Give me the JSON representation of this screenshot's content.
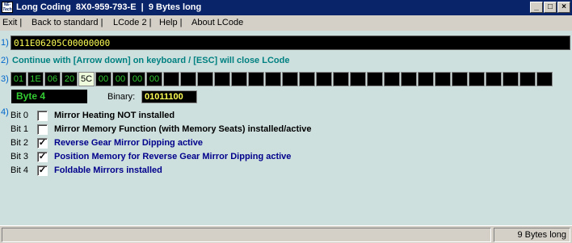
{
  "window": {
    "icon_text": "NE-Tech",
    "title": "Long Coding  8X0-959-793-E  |  9 Bytes long",
    "buttons": {
      "minimize": "_",
      "maximize": "□",
      "close": "×"
    }
  },
  "menu": [
    "Exit |",
    "Back to standard |",
    "LCode 2 |",
    "Help |",
    "About LCode"
  ],
  "step_numbers": [
    "1)",
    "2)",
    "3)",
    "4)"
  ],
  "coding_string": "011E06205C00000000",
  "hint": "Continue with [Arrow down] on keyboard / [ESC] will close LCode",
  "bytes": [
    "01",
    "1E",
    "06",
    "20",
    "5C",
    "00",
    "00",
    "00",
    "00",
    "",
    "",
    "",
    "",
    "",
    "",
    "",
    "",
    "",
    "",
    "",
    "",
    "",
    "",
    "",
    "",
    "",
    "",
    "",
    "",
    "",
    "",
    ""
  ],
  "selected_byte_index": 4,
  "byte_label": "Byte 4",
  "binary_label": "Binary:",
  "binary_value": "01011100",
  "bits": [
    {
      "name": "Bit 0",
      "checked": false,
      "desc": "Mirror Heating NOT installed"
    },
    {
      "name": "Bit 1",
      "checked": false,
      "desc": "Mirror Memory Function (with Memory Seats) installed/active"
    },
    {
      "name": "Bit 2",
      "checked": true,
      "desc": "Reverse Gear Mirror Dipping active"
    },
    {
      "name": "Bit 3",
      "checked": true,
      "desc": "Position Memory for Reverse Gear Mirror Dipping active"
    },
    {
      "name": "Bit 4",
      "checked": true,
      "desc": "Foldable Mirrors installed"
    }
  ],
  "status": {
    "left": "",
    "right": "9 Bytes long"
  },
  "colors": {
    "title_bg": "#0a246a",
    "client_bg": "#cde0de",
    "byte_text": "#33cc33",
    "code_text": "#ffff55",
    "hint": "#008080",
    "active_bit": "#00008b"
  }
}
